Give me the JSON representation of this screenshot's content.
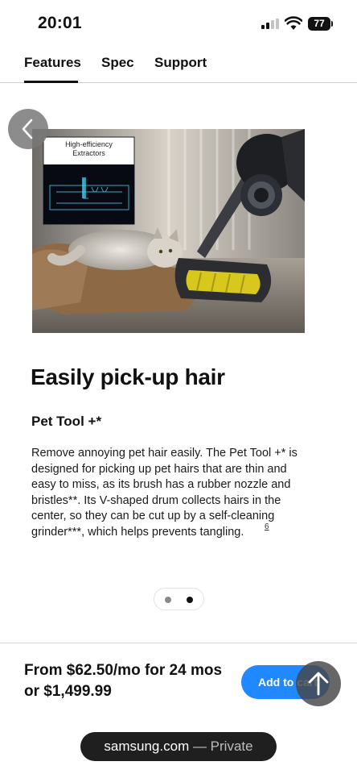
{
  "status_bar": {
    "time": "20:01",
    "battery": "77",
    "icons": [
      "cellular-signal-icon",
      "wifi-icon",
      "battery-icon"
    ]
  },
  "tabs": [
    {
      "label": "Features",
      "active": true
    },
    {
      "label": "Spec",
      "active": false
    },
    {
      "label": "Support",
      "active": false
    }
  ],
  "hero": {
    "inset_label": "High-efficiency Extractors",
    "inset_label_line1": "High-efficiency",
    "inset_label_line2": "Extractors"
  },
  "feature": {
    "headline": "Easily pick-up hair",
    "subhead": "Pet Tool +*",
    "body": "Remove annoying pet hair easily. The Pet Tool +* is designed for picking up pet hairs that are thin and easy to miss, as its brush has a rubber nozzle and bristles**. Its V-shaped drum collects hairs in the center, so they can be cut up by a self-cleaning grinder***, which helps prevents tangling.",
    "footnote": "6"
  },
  "carousel": {
    "total": 2,
    "active": 2
  },
  "purchase": {
    "price_text": "From $62.50/mo for 24 mos or $1,499.99",
    "add_to_cart_label": "Add to cart"
  },
  "browser": {
    "domain": "samsung.com",
    "mode": "— Private"
  },
  "colors": {
    "accent_blue": "#2189ff",
    "text": "#111111",
    "brush_yellow": "#e6d21c"
  }
}
